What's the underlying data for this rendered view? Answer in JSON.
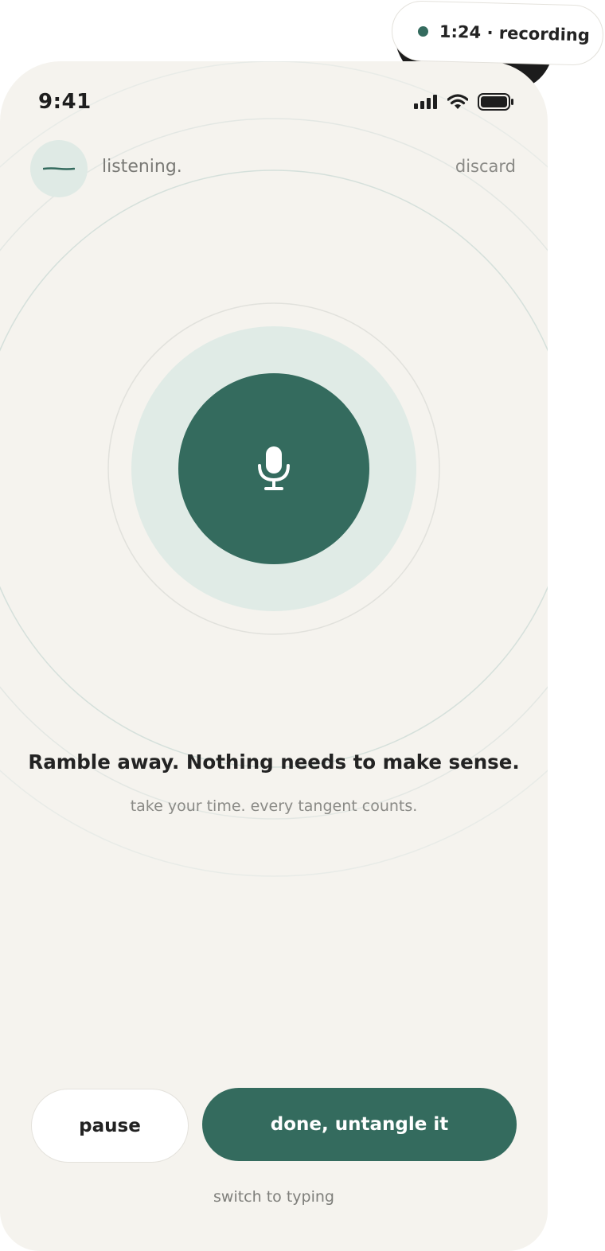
{
  "status_bar": {
    "time": "9:41",
    "icons": [
      "cellular-signal-icon",
      "wifi-icon",
      "battery-icon"
    ]
  },
  "header": {
    "avatar_icon": "waveform-line-icon",
    "status_label": "listening.",
    "discard_label": "discard"
  },
  "mic": {
    "icon": "microphone-icon"
  },
  "prompt": {
    "headline": "Ramble away. Nothing needs to make sense.",
    "subline": "take your time. every tangent counts."
  },
  "actions": {
    "pause_label": "pause",
    "done_label": "done, untangle it",
    "switch_label": "switch to typing"
  },
  "recording_pill": {
    "timer": "1:24",
    "separator": "·",
    "label": "recording"
  },
  "colors": {
    "accent": "#346b5e",
    "accent_light": "#e0ebe6",
    "background": "#f5f3ee"
  }
}
